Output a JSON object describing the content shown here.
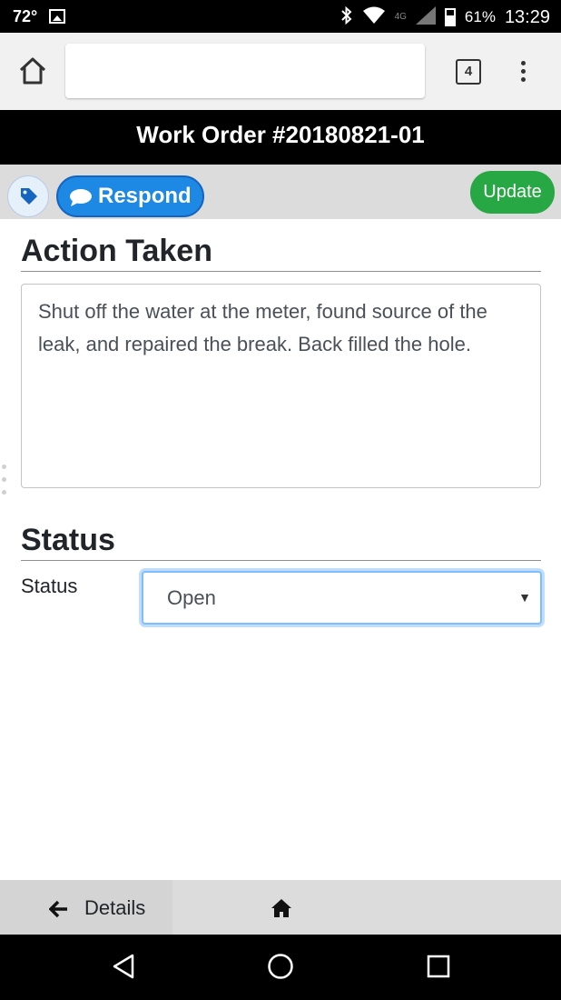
{
  "status_bar": {
    "temperature": "72°",
    "battery_percent": "61%",
    "time": "13:29",
    "network": "4G"
  },
  "browser": {
    "url": "",
    "tab_count": "4"
  },
  "page": {
    "title": "Work Order #20180821-01"
  },
  "actions": {
    "respond_label": "Respond",
    "update_label": "Update"
  },
  "action_taken": {
    "heading": "Action Taken",
    "text": "Shut off the water at the meter, found source of the leak, and repaired the break. Back filled the hole."
  },
  "status_section": {
    "heading": "Status",
    "label": "Status",
    "selected": "Open"
  },
  "bottom_nav": {
    "details_label": "Details"
  },
  "colors": {
    "respond_blue": "#1e88e5",
    "update_green": "#28a745",
    "title_bar_bg": "#000000",
    "focus_border": "#80bdff"
  }
}
